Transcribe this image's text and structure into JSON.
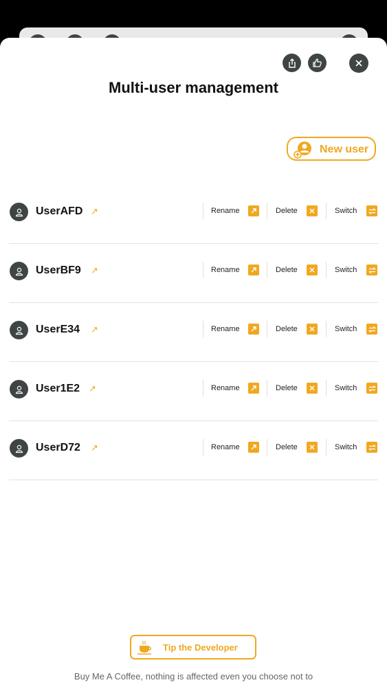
{
  "header": {
    "title": "Multi-user management"
  },
  "toolbar": {
    "share_icon": "share-icon",
    "like_icon": "thumbs-up-icon",
    "close_icon": "close-icon"
  },
  "new_user_button": {
    "label": "New user",
    "icon": "add-user-icon"
  },
  "users": [
    {
      "name": "UserAFD"
    },
    {
      "name": "UserBF9"
    },
    {
      "name": "UserE34"
    },
    {
      "name": "User1E2"
    },
    {
      "name": "UserD72"
    }
  ],
  "row_actions": {
    "rename": "Rename",
    "delete": "Delete",
    "switch": "Switch"
  },
  "tip": {
    "label": "Tip the Developer",
    "icon": "coffee-icon"
  },
  "footer": {
    "text": "Buy Me A Coffee, nothing is affected even you choose not to"
  },
  "colors": {
    "accent": "#f0a820",
    "dark": "#3f4545",
    "divider": "#e2e2e2"
  }
}
